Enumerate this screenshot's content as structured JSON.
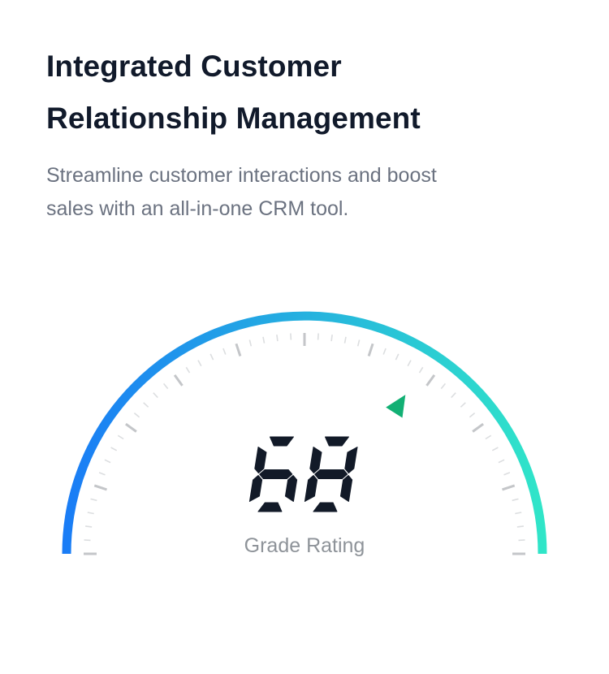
{
  "header": {
    "title_line1": "Integrated Customer",
    "title_line2": "Relationship Management",
    "subtitle_line1": "Streamline customer interactions and boost",
    "subtitle_line2": "sales with an all-in-one CRM tool."
  },
  "gauge": {
    "value": 68,
    "value_text": "68",
    "max": 100,
    "label": "Grade Rating",
    "pointer_icon": "triangle-pointer-icon",
    "colors": {
      "arc_start": "#1a7cf6",
      "arc_end": "#30e6c8",
      "pointer": "#12b074",
      "digits": "#121a28",
      "tick_major": "#c4c6c9",
      "tick_minor": "#dcdee0"
    }
  }
}
